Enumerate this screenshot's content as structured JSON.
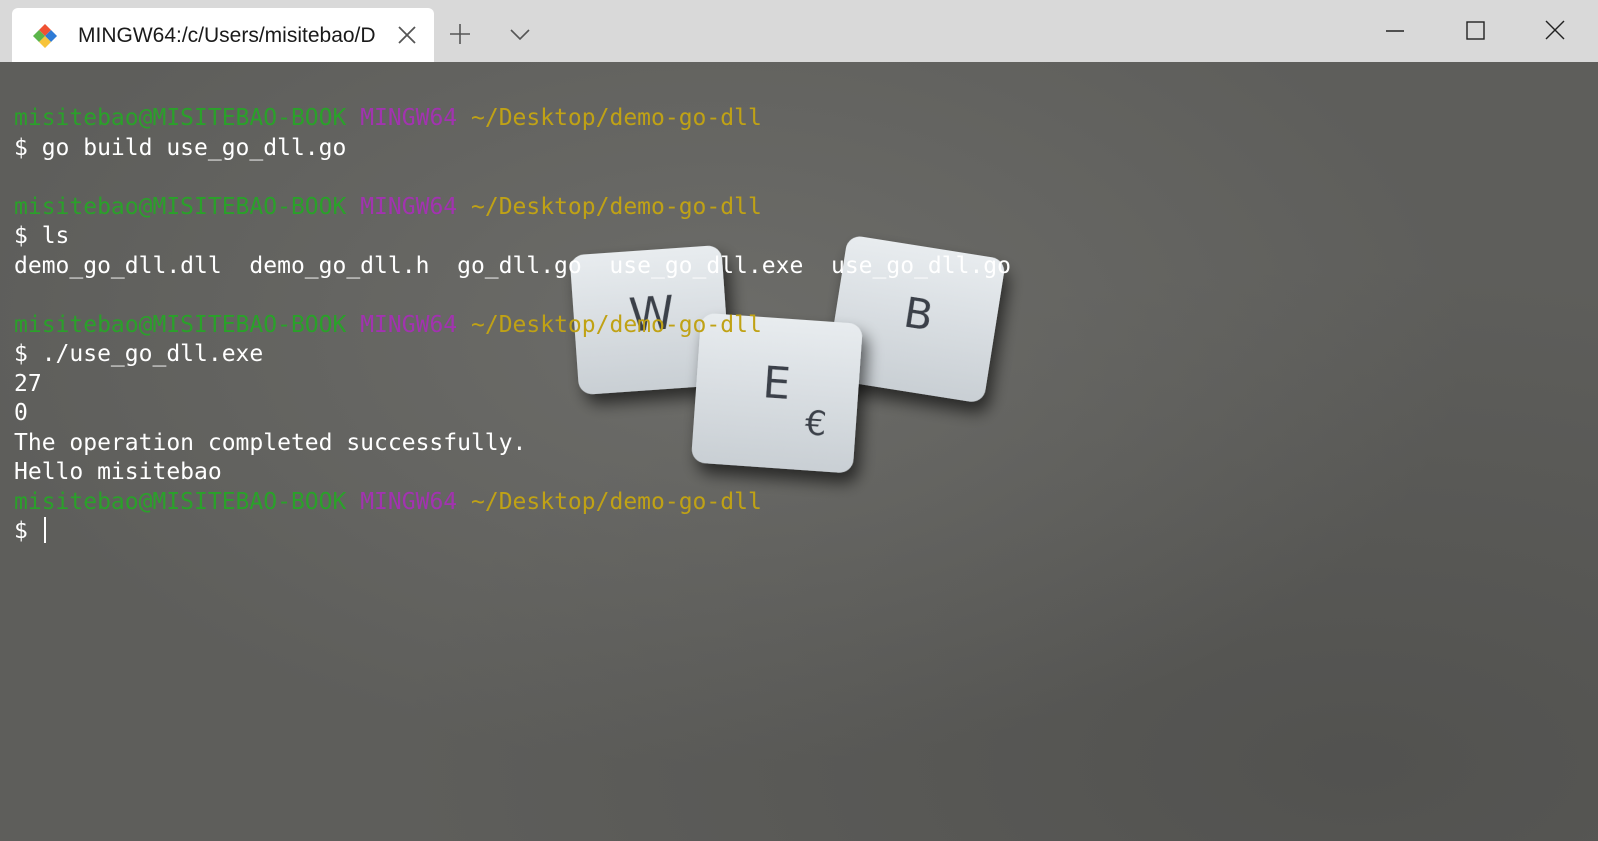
{
  "tab": {
    "title": "MINGW64:/c/Users/misitebao/D",
    "icon": "git-bash-icon"
  },
  "window_controls": {
    "new_tab_icon": "plus-icon",
    "dropdown_icon": "chevron-down-icon",
    "minimize_icon": "minimize-icon",
    "maximize_icon": "maximize-icon",
    "close_icon": "close-icon"
  },
  "terminal": {
    "prompts": [
      {
        "user": "misitebao@MISITEBAO-BOOK",
        "shell": "MINGW64",
        "path": "~/Desktop/demo-go-dll"
      },
      {
        "user": "misitebao@MISITEBAO-BOOK",
        "shell": "MINGW64",
        "path": "~/Desktop/demo-go-dll"
      },
      {
        "user": "misitebao@MISITEBAO-BOOK",
        "shell": "MINGW64",
        "path": "~/Desktop/demo-go-dll"
      },
      {
        "user": "misitebao@MISITEBAO-BOOK",
        "shell": "MINGW64",
        "path": "~/Desktop/demo-go-dll"
      }
    ],
    "commands": [
      "$ go build use_go_dll.go",
      "$ ls",
      "$ ./use_go_dll.exe",
      "$"
    ],
    "ls_output": "demo_go_dll.dll  demo_go_dll.h  go_dll.go  use_go_dll.exe  use_go_dll.go",
    "run_output": [
      "27",
      "0",
      "The operation completed successfully.",
      "Hello misitebao"
    ]
  },
  "background": {
    "tiles": [
      "W",
      "E",
      "B"
    ],
    "tile_symbol": "€"
  },
  "colors": {
    "user": "#2aa12a",
    "shell": "#a233b0",
    "path": "#c0a215",
    "text": "#ffffff",
    "terminal_bg": "#5e5e5b",
    "titlebar_bg": "#d9d9d9"
  }
}
